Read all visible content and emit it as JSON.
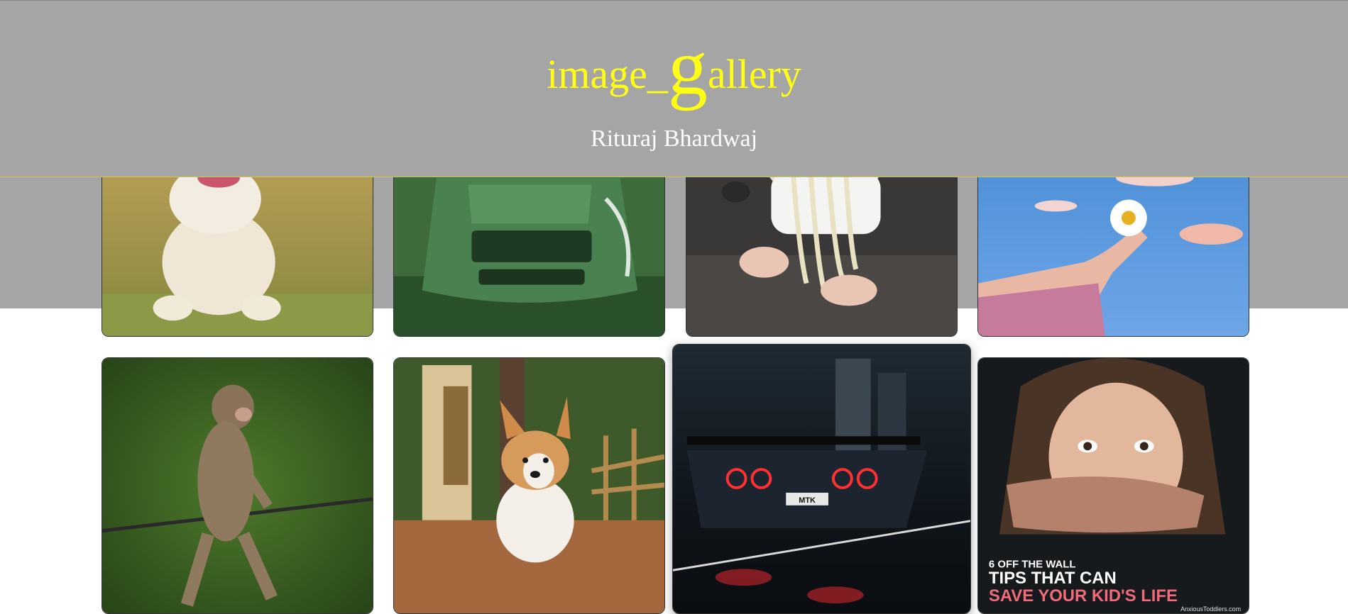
{
  "header": {
    "title_prefix": "image_",
    "title_big_letter": "g",
    "title_suffix": "allery",
    "author": "Rituraj Bhardwaj"
  },
  "colors": {
    "header_bg": "#a5a5a5",
    "title": "#ffff14",
    "author": "#ffffff"
  },
  "gallery": {
    "row1": [
      {
        "subject": "puppy running on grass"
      },
      {
        "subject": "green sports car top view"
      },
      {
        "subject": "baby with spaghetti"
      },
      {
        "subject": "hand holding daisy against sky"
      }
    ],
    "row2": [
      {
        "subject": "monkey on rope"
      },
      {
        "subject": "corgi puppy on table"
      },
      {
        "subject": "sports car at night in rain"
      },
      {
        "subject": "child with hand over mouth poster"
      }
    ],
    "poster_text": {
      "line1": "6 OFF THE WALL",
      "line2": "TIPS THAT CAN",
      "line3": "SAVE YOUR KID'S LIFE",
      "credit": "AnxiousToddlers.com"
    },
    "car_plate": "MTK"
  }
}
